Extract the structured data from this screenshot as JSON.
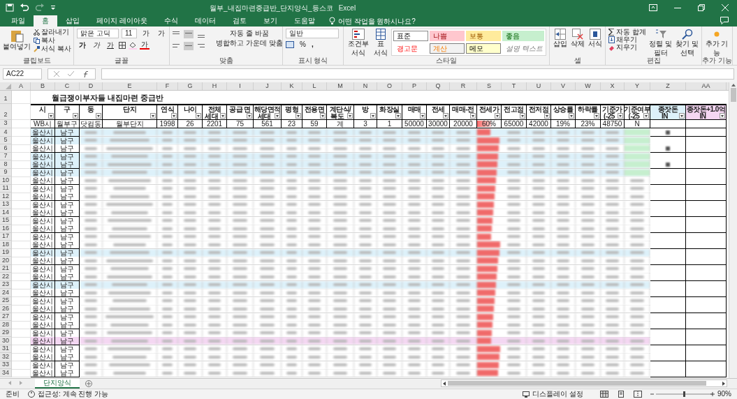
{
  "window": {
    "title": "월부_내집마련중급반_단지양식_등스코",
    "app": "Excel"
  },
  "tabs": [
    {
      "label": "파일",
      "selected": false
    },
    {
      "label": "홈",
      "selected": true
    },
    {
      "label": "삽입",
      "selected": false
    },
    {
      "label": "페이지 레이아웃",
      "selected": false
    },
    {
      "label": "수식",
      "selected": false
    },
    {
      "label": "데이터",
      "selected": false
    },
    {
      "label": "검토",
      "selected": false
    },
    {
      "label": "보기",
      "selected": false
    },
    {
      "label": "도움말",
      "selected": false
    }
  ],
  "tell_me": "어떤 작업을 원하시나요?",
  "ribbon": {
    "groups": [
      {
        "kind": "clipboard",
        "label": "클립보드",
        "paste": "붙여넣기",
        "items": [
          "잘라내기",
          "복사",
          "서식 복사"
        ]
      },
      {
        "kind": "font",
        "label": "글꼴",
        "font": "맑은 고딕",
        "size": "11",
        "grow": "가",
        "shrink": "가",
        "styles": [
          "가",
          "가",
          "가"
        ],
        "font_color": "가"
      },
      {
        "kind": "alignment",
        "label": "맞춤",
        "wrap": "자동 줄 바꿈",
        "merge": "병합하고 가운데 맞춤"
      },
      {
        "kind": "number",
        "label": "표시 형식",
        "format": "일반",
        "percent": "%",
        "comma": ","
      },
      {
        "kind": "styles",
        "label": "스타일",
        "conditional": "조건부 서식",
        "table": "표 서식",
        "cell_styles": [
          {
            "label": "표준",
            "color": "#ffffff",
            "kind": "normal"
          },
          {
            "label": "나쁨",
            "color": "#ffc7ce",
            "kind": "bad"
          },
          {
            "label": "보통",
            "color": "#ffeb9c",
            "kind": "neutral"
          },
          {
            "label": "좋음",
            "color": "#c6efce",
            "kind": "good"
          },
          {
            "label": "경고문",
            "color": "#ffffff",
            "kind": "warning"
          },
          {
            "label": "계산",
            "color": "#f2f2f2",
            "kind": "calculation"
          },
          {
            "label": "메모",
            "color": "#ffffcc",
            "kind": "note"
          },
          {
            "label": "설명 텍스트",
            "color": "#ffffff",
            "kind": "explanatory"
          }
        ]
      },
      {
        "kind": "cells",
        "label": "셀",
        "buttons": [
          "삽입",
          "삭제",
          "서식"
        ]
      },
      {
        "kind": "editing",
        "label": "편집",
        "items": [
          "자동 합계",
          "채우기",
          "지우기"
        ],
        "buttons": [
          "정렬 및 필터",
          "찾기 및 선택"
        ]
      },
      {
        "kind": "addins",
        "label": "추가 기능",
        "buttons": [
          "추가 기능"
        ]
      }
    ]
  },
  "formula_bar": {
    "name_box": "AC22"
  },
  "columns": [
    "A",
    "B",
    "C",
    "D",
    "E",
    "F",
    "G",
    "H",
    "I",
    "J",
    "K",
    "L",
    "M",
    "N",
    "O",
    "P",
    "Q",
    "R",
    "S",
    "T",
    "U",
    "V",
    "W",
    "X",
    "Y",
    "Z",
    "AA"
  ],
  "header_row_numbers": [
    "1",
    "2",
    "3"
  ],
  "title_cell": "월급쟁이부자들 내집마련 중급반",
  "headers": [
    {
      "lines": [
        "시"
      ]
    },
    {
      "lines": [
        "구"
      ]
    },
    {
      "lines": [
        "동"
      ]
    },
    {
      "lines": [
        "단지"
      ]
    },
    {
      "lines": [
        "연식"
      ]
    },
    {
      "lines": [
        "나이"
      ]
    },
    {
      "lines": [
        "전체",
        "세대"
      ]
    },
    {
      "lines": [
        "공급 면"
      ]
    },
    {
      "lines": [
        "해당면적",
        "세대"
      ]
    },
    {
      "lines": [
        "평형"
      ]
    },
    {
      "lines": [
        "전용면"
      ]
    },
    {
      "lines": [
        "계단식/",
        "복도"
      ]
    },
    {
      "lines": [
        "방"
      ]
    },
    {
      "lines": [
        "화장실"
      ]
    },
    {
      "lines": [
        "매매"
      ]
    },
    {
      "lines": [
        "전세"
      ]
    },
    {
      "lines": [
        "매매-전"
      ]
    },
    {
      "lines": [
        "전세가"
      ]
    },
    {
      "lines": [
        "전고점"
      ]
    },
    {
      "lines": [
        "전저점"
      ]
    },
    {
      "lines": [
        "상승률"
      ]
    },
    {
      "lines": [
        "하락률"
      ]
    },
    {
      "lines": [
        "기준가",
        "(-25"
      ]
    },
    {
      "lines": [
        "기준여부",
        "(-25"
      ]
    },
    {
      "lines": [
        "종잣돈",
        "IN"
      ],
      "color": "#ddf1fa"
    },
    {
      "lines": [
        "종잣돈+1.0억",
        "IN"
      ],
      "color": "#f4d7f2"
    }
  ],
  "sample_row": [
    {
      "text": "WB시"
    },
    {
      "text": "월부구"
    },
    {
      "text": "닷컴동"
    },
    {
      "text": "월부단지"
    },
    {
      "text": "1998"
    },
    {
      "text": "26"
    },
    {
      "text": "2201"
    },
    {
      "text": "75"
    },
    {
      "text": "561"
    },
    {
      "text": "23"
    },
    {
      "text": "59"
    },
    {
      "text": "계"
    },
    {
      "text": "3"
    },
    {
      "text": "1"
    },
    {
      "text": "50000"
    },
    {
      "text": "30000"
    },
    {
      "text": "20000"
    },
    {
      "text": "60%",
      "level": 0.6
    },
    {
      "text": "65000"
    },
    {
      "text": "42000"
    },
    {
      "text": "19%"
    },
    {
      "text": "23%"
    },
    {
      "text": "48750"
    },
    {
      "text": "N"
    }
  ],
  "rows": [
    {
      "number": "4",
      "city": "울산시",
      "district": "남구",
      "color": "#ddf1fa"
    },
    {
      "number": "5",
      "city": "울산시",
      "district": "남구",
      "color": "#ddf1fa"
    },
    {
      "number": "6",
      "city": "울산시",
      "district": "남구"
    },
    {
      "number": "7",
      "city": "울산시",
      "district": "남구",
      "color": "#ddf1fa"
    },
    {
      "number": "8",
      "city": "울산시",
      "district": "남구",
      "color": "#ddf1fa"
    },
    {
      "number": "9",
      "city": "울산시",
      "district": "남구",
      "color": "#ddf1fa"
    },
    {
      "number": "10",
      "city": "울산시",
      "district": "남구"
    },
    {
      "number": "11",
      "city": "울산시",
      "district": "남구"
    },
    {
      "number": "12",
      "city": "울산시",
      "district": "남구"
    },
    {
      "number": "13",
      "city": "울산시",
      "district": "남구"
    },
    {
      "number": "14",
      "city": "울산시",
      "district": "남구"
    },
    {
      "number": "15",
      "city": "울산시",
      "district": "남구"
    },
    {
      "number": "16",
      "city": "울산시",
      "district": "남구"
    },
    {
      "number": "17",
      "city": "울산시",
      "district": "남구"
    },
    {
      "number": "18",
      "city": "울산시",
      "district": "남구"
    },
    {
      "number": "19",
      "city": "울산시",
      "district": "남구",
      "color": "#ddf1fa"
    },
    {
      "number": "20",
      "city": "울산시",
      "district": "남구"
    },
    {
      "number": "21",
      "city": "울산시",
      "district": "남구"
    },
    {
      "number": "22",
      "city": "울산시",
      "district": "남구"
    },
    {
      "number": "23",
      "city": "울산시",
      "district": "남구",
      "color": "#ddf1fa"
    },
    {
      "number": "24",
      "city": "울산시",
      "district": "남구"
    },
    {
      "number": "25",
      "city": "울산시",
      "district": "남구"
    },
    {
      "number": "26",
      "city": "울산시",
      "district": "남구"
    },
    {
      "number": "27",
      "city": "울산시",
      "district": "남구"
    },
    {
      "number": "28",
      "city": "울산시",
      "district": "남구"
    },
    {
      "number": "29",
      "city": "울산시",
      "district": "남구"
    },
    {
      "number": "30",
      "city": "울산시",
      "district": "남구",
      "color": "#f4d7f2"
    },
    {
      "number": "31",
      "city": "울산시",
      "district": "남구"
    },
    {
      "number": "32",
      "city": "울산시",
      "district": "남구"
    },
    {
      "number": "33",
      "city": "울산시",
      "district": "남구"
    },
    {
      "number": "34",
      "city": "울산시",
      "district": "남구"
    }
  ],
  "sheet_tabs": [
    {
      "label": "단지양식",
      "selected": true
    }
  ],
  "status_bar": {
    "mode": "준비",
    "accessibility": "접근성: 계속 진행 가능",
    "display": "디스플레이 설정",
    "zoom": "90%"
  }
}
